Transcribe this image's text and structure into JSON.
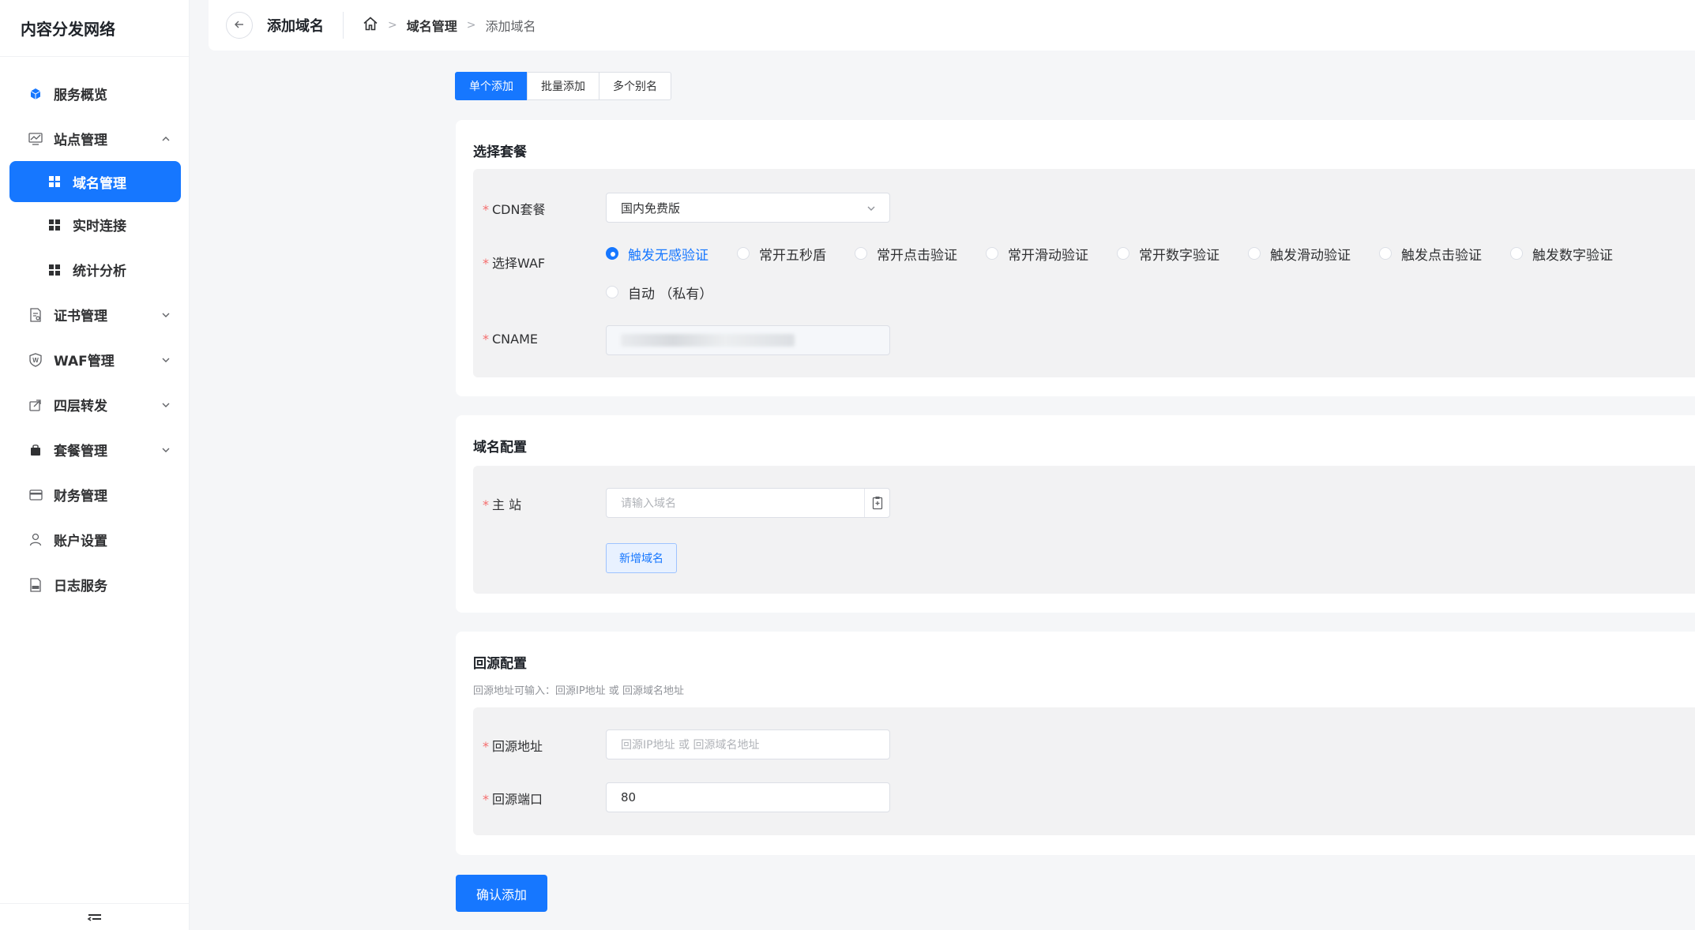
{
  "app": {
    "brand": "内容分发网络"
  },
  "sidebar": {
    "items": [
      {
        "label": "服务概览",
        "icon": "cube-icon"
      },
      {
        "label": "站点管理",
        "icon": "chart-icon",
        "expanded": true
      },
      {
        "label": "域名管理",
        "icon": "grid-icon",
        "active": true
      },
      {
        "label": "实时连接",
        "icon": "grid-icon"
      },
      {
        "label": "统计分析",
        "icon": "grid-icon"
      },
      {
        "label": "证书管理",
        "icon": "certificate-icon"
      },
      {
        "label": "WAF管理",
        "icon": "shield-icon"
      },
      {
        "label": "四层转发",
        "icon": "forward-icon"
      },
      {
        "label": "套餐管理",
        "icon": "bag-icon"
      },
      {
        "label": "财务管理",
        "icon": "card-icon"
      },
      {
        "label": "账户设置",
        "icon": "user-icon"
      },
      {
        "label": "日志服务",
        "icon": "log-icon"
      }
    ]
  },
  "header": {
    "title": "添加域名",
    "breadcrumb": {
      "parent": "域名管理",
      "current": "添加域名"
    }
  },
  "tabs": [
    "单个添加",
    "批量添加",
    "多个别名"
  ],
  "package_section": {
    "title": "选择套餐",
    "cdn_label": "CDN套餐",
    "cdn_value": "国内免费版",
    "waf_label": "选择WAF",
    "waf_options": [
      "触发无感验证",
      "常开五秒盾",
      "常开点击验证",
      "常开滑动验证",
      "常开数字验证",
      "触发滑动验证",
      "触发点击验证",
      "触发数字验证",
      "自动 （私有）"
    ],
    "waf_selected": "触发无感验证",
    "cname_label": "CNAME"
  },
  "domain_section": {
    "title": "域名配置",
    "main_label": "主 站",
    "main_placeholder": "请输入域名",
    "add_button": "新增域名"
  },
  "origin_section": {
    "title": "回源配置",
    "hint": "回源地址可输入：回源IP地址 或 回源域名地址",
    "addr_label": "回源地址",
    "addr_placeholder": "回源IP地址 或 回源域名地址",
    "port_label": "回源端口",
    "port_value": "80"
  },
  "submit_label": "确认添加",
  "colors": {
    "primary": "#1677ff",
    "required": "#f56c6c"
  }
}
